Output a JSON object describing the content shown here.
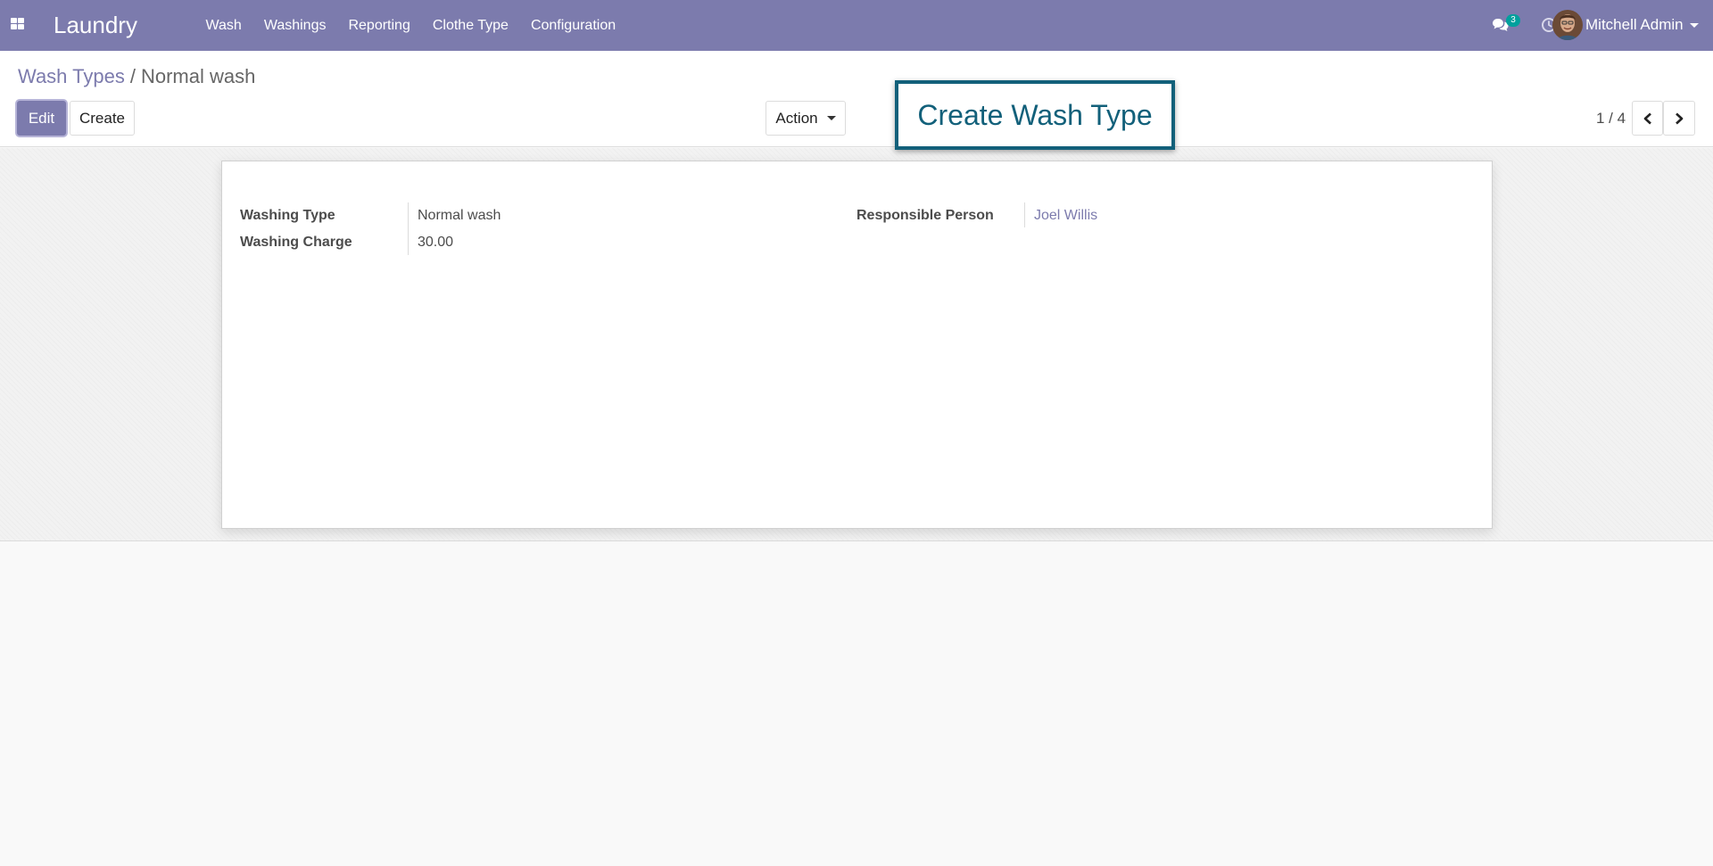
{
  "navbar": {
    "brand": "Laundry",
    "menu": [
      "Wash",
      "Washings",
      "Reporting",
      "Clothe Type",
      "Configuration"
    ],
    "messages_count": "3",
    "user_name": "Mitchell Admin",
    "icons": [
      "apps-icon",
      "chat-icon",
      "clock-icon",
      "avatar"
    ]
  },
  "breadcrumb": {
    "parent": "Wash Types",
    "separator": "/",
    "current": "Normal wash"
  },
  "buttons": {
    "edit": "Edit",
    "create": "Create",
    "action": "Action"
  },
  "pager": {
    "value": "1 / 4"
  },
  "callout": {
    "text": "Create Wash Type"
  },
  "form": {
    "washing_type_label": "Washing Type",
    "washing_type_value": "Normal wash",
    "washing_charge_label": "Washing Charge",
    "washing_charge_value": "30.00",
    "responsible_label": "Responsible Person",
    "responsible_value": "Joel Willis"
  },
  "colors": {
    "brand": "#7c7bad",
    "callout": "#12607a",
    "badge": "#00a09d"
  }
}
